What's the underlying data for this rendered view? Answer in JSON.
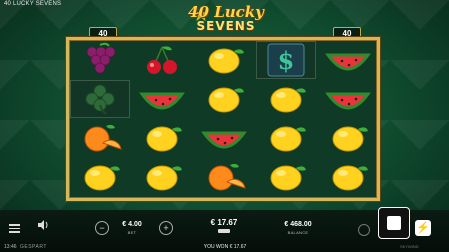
{
  "header": {
    "game_title": "40 LUCKY SEVENS"
  },
  "logo": {
    "line1": "40 Lucky",
    "line2": "SEVENS"
  },
  "paylines": {
    "left": "40",
    "right": "40"
  },
  "reels": [
    [
      "grapes",
      "clover",
      "orange",
      "lemon"
    ],
    [
      "cherry",
      "watermelon",
      "lemon",
      "lemon"
    ],
    [
      "lemon",
      "lemon",
      "watermelon",
      "orange"
    ],
    [
      "dollar",
      "lemon",
      "lemon",
      "lemon"
    ],
    [
      "watermelon",
      "watermelon",
      "lemon",
      "lemon"
    ]
  ],
  "held": [
    "0-1",
    "3-0"
  ],
  "controls": {
    "bet_value": "€ 4.00",
    "bet_label": "BET",
    "win_value": "€ 17.67",
    "balance_value": "€ 468.00",
    "balance_label": "BALANCE",
    "turbo_glyph": "⚡"
  },
  "status": {
    "clock": "13:46",
    "brand": "GESPART",
    "won_text": "YOU WON € 17.67",
    "right_brand": "SKYWIND"
  },
  "colors": {
    "frame": "#d9b65a",
    "background": "#0f4a2d"
  }
}
